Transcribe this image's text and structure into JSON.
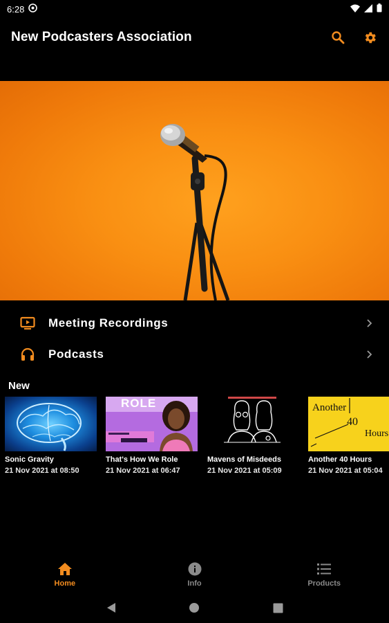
{
  "status_bar": {
    "time": "6:28"
  },
  "app_bar": {
    "title": "New Podcasters Association",
    "accent": "#f28c1f"
  },
  "menu": {
    "items": [
      {
        "label": "Meeting Recordings",
        "icon": "tv-play-icon"
      },
      {
        "label": "Podcasts",
        "icon": "headphones-icon"
      }
    ]
  },
  "new_section": {
    "title": "New",
    "items": [
      {
        "title": "Sonic Gravity",
        "date": "21 Nov 2021 at 08:50"
      },
      {
        "title": "That's How We Role",
        "date": "21 Nov 2021 at 06:47",
        "art_text": "ROLE"
      },
      {
        "title": "Mavens of Misdeeds",
        "date": "21 Nov 2021 at 05:09"
      },
      {
        "title": "Another 40 Hours",
        "date": "21 Nov 2021 at 05:04",
        "art_text": [
          "Another",
          "40",
          "Hours"
        ]
      }
    ]
  },
  "bottom_nav": {
    "items": [
      {
        "label": "Home",
        "icon": "home-icon",
        "active": true
      },
      {
        "label": "Info",
        "icon": "info-icon",
        "active": false
      },
      {
        "label": "Products",
        "icon": "list-icon",
        "active": false
      }
    ],
    "active_color": "#f28c1f",
    "inactive_color": "#8a8a8a"
  }
}
